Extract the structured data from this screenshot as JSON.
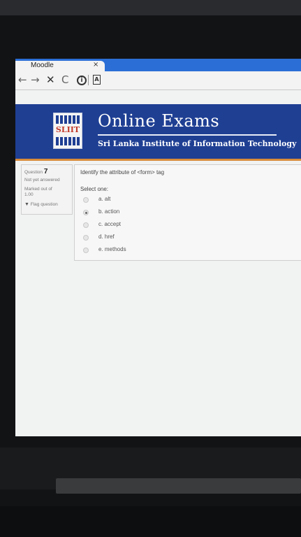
{
  "browser": {
    "tab_title": "Moodle",
    "tab_close": "×",
    "back": "←",
    "forward": "→",
    "stop": "✕",
    "reload": "C"
  },
  "banner": {
    "logo_text": "SLIIT",
    "title": "Online Exams",
    "subtitle": "Sri Lanka Institute of Information Technology",
    "colors": {
      "banner_bg": "#1f3f93",
      "accent": "#d98b3a"
    }
  },
  "question_info": {
    "label": "Question",
    "number": "7",
    "status": "Not yet answered",
    "marked_out_of_label": "Marked out of",
    "marked_out_of_value": "1.00",
    "flag_label": "Flag question"
  },
  "question": {
    "text": "Identify the attribute of <form> tag",
    "select_label": "Select one:",
    "options": [
      {
        "label": "a. alt",
        "selected": false
      },
      {
        "label": "b. action",
        "selected": true
      },
      {
        "label": "c. accept",
        "selected": false
      },
      {
        "label": "d. href",
        "selected": false
      },
      {
        "label": "e. methods",
        "selected": false
      }
    ]
  }
}
